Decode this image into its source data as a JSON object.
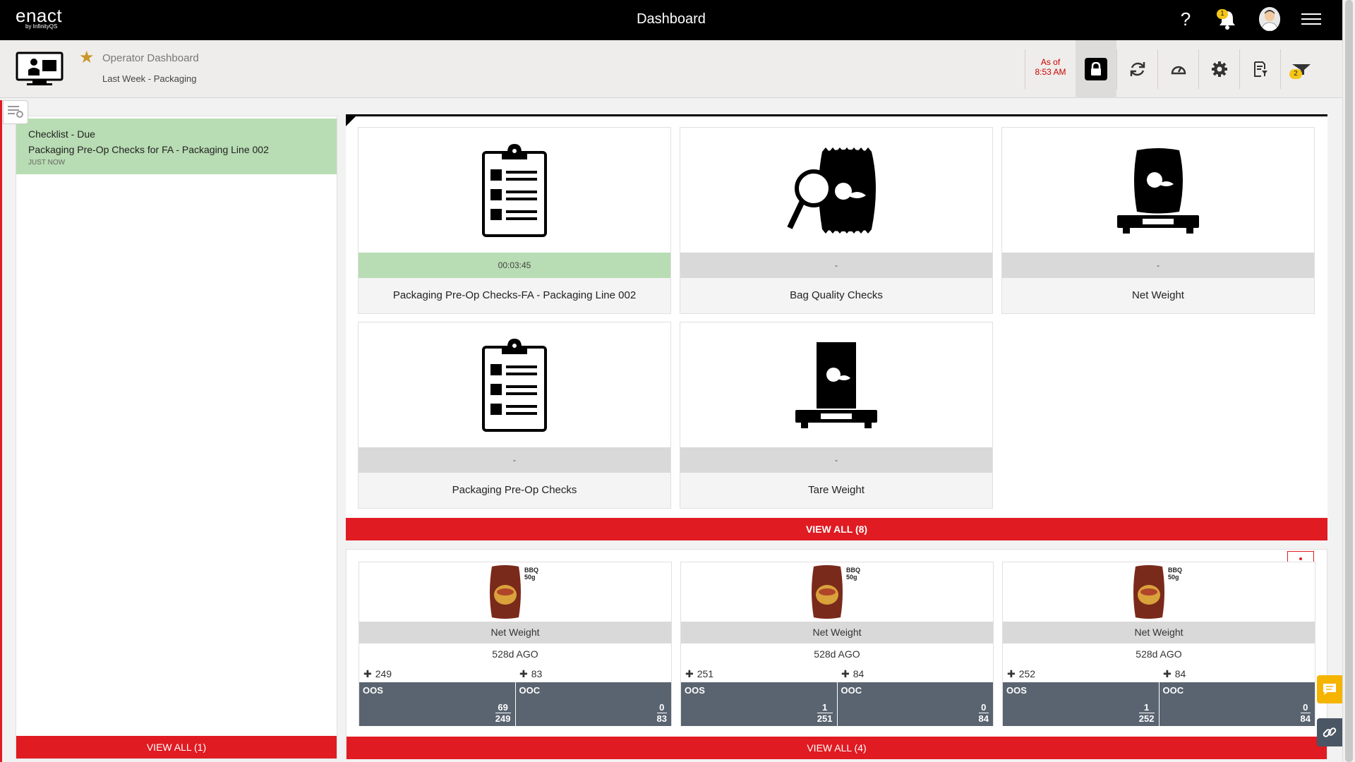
{
  "app": {
    "logo_main": "enact",
    "logo_sub": "by InfinityQS",
    "title": "Dashboard",
    "help_label": "?",
    "notification_count": "1"
  },
  "subheader": {
    "dashboard_name": "Operator Dashboard",
    "dashboard_filter": "Last Week - Packaging",
    "asof_label": "As of",
    "asof_time": "8:53 AM",
    "filter_count": "2"
  },
  "left_panel": {
    "notification": {
      "type": "Checklist - Due",
      "name": "Packaging Pre-Op Checks for FA - Packaging Line 002",
      "time": "JUST NOW"
    },
    "view_all": "VIEW ALL  (1)"
  },
  "checklist_panel": {
    "cards": [
      {
        "name": "Packaging Pre-Op Checks-FA - Packaging Line 002",
        "status": "00:03:45",
        "icon": "clipboard-icon"
      },
      {
        "name": "Bag Quality Checks",
        "status": "-",
        "icon": "bag-magnifier-icon"
      },
      {
        "name": "Net Weight",
        "status": "-",
        "icon": "bag-scale-icon"
      },
      {
        "name": "Packaging Pre-Op Checks",
        "status": "-",
        "icon": "clipboard-icon"
      },
      {
        "name": "Tare Weight",
        "status": "-",
        "icon": "tall-bag-scale-icon"
      }
    ],
    "view_all": "VIEW ALL (8)"
  },
  "product_panel": {
    "cards": [
      {
        "title": "Net Weight",
        "ago": "528d AGO",
        "count_a": "249",
        "count_b": "83",
        "oos_label": "OOS",
        "oos_num": "69",
        "oos_den": "249",
        "ooc_label": "OOC",
        "ooc_num": "0",
        "ooc_den": "83",
        "pack_flavor": "BBQ",
        "pack_size": "50g"
      },
      {
        "title": "Net Weight",
        "ago": "528d AGO",
        "count_a": "251",
        "count_b": "84",
        "oos_label": "OOS",
        "oos_num": "1",
        "oos_den": "251",
        "ooc_label": "OOC",
        "ooc_num": "0",
        "ooc_den": "84",
        "pack_flavor": "BBQ",
        "pack_size": "50g"
      },
      {
        "title": "Net Weight",
        "ago": "528d AGO",
        "count_a": "252",
        "count_b": "84",
        "oos_label": "OOS",
        "oos_num": "1",
        "oos_den": "252",
        "ooc_label": "OOC",
        "ooc_num": "0",
        "ooc_den": "84",
        "pack_flavor": "BBQ",
        "pack_size": "50g"
      }
    ],
    "view_all": "VIEW ALL (4)"
  },
  "colors": {
    "accent_red": "#e01b22",
    "due_green": "#b8dcb3",
    "metric_slate": "#5a6470",
    "badge_yellow": "#f5c518"
  }
}
